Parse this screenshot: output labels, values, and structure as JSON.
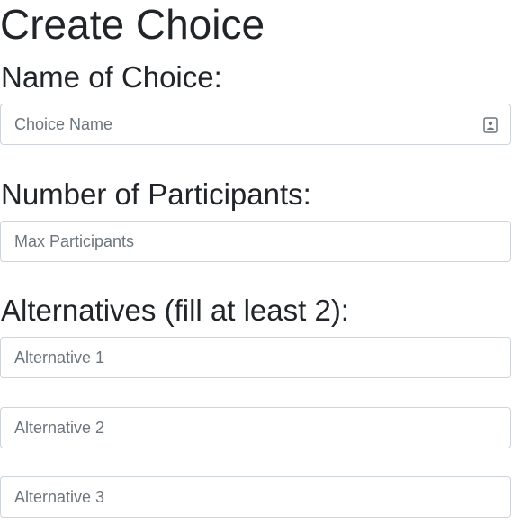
{
  "page": {
    "title": "Create Choice"
  },
  "form": {
    "name_label": "Name of Choice:",
    "name_placeholder": "Choice Name",
    "participants_label": "Number of Participants:",
    "participants_placeholder": "Max Participants",
    "alternatives_label": "Alternatives (fill at least 2):",
    "alternatives": [
      {
        "placeholder": "Alternative 1"
      },
      {
        "placeholder": "Alternative 2"
      },
      {
        "placeholder": "Alternative 3"
      }
    ]
  },
  "icons": {
    "name_field_icon": "contact-card-icon"
  }
}
